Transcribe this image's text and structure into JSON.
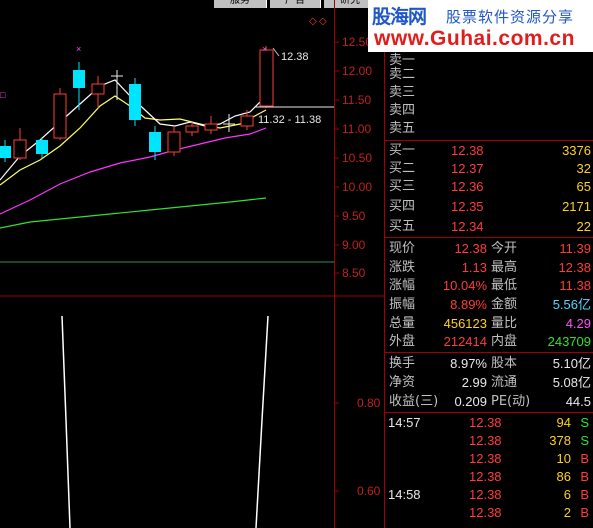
{
  "tabs": [
    "服务",
    "广告",
    "研究"
  ],
  "watermark": {
    "brand": "股海网",
    "slogan": "股票软件资源分享",
    "url": "www.Guhai.com.cn"
  },
  "chart": {
    "price_axis": [
      "12.50",
      "12.00",
      "11.50",
      "11.00",
      "10.50",
      "10.00",
      "9.50",
      "9.00",
      "8.50"
    ],
    "indicator_axis": [
      "0.80",
      "0.60"
    ],
    "high_label": "12.38",
    "range_label": "11.32 - 11.38"
  },
  "colors": {
    "up": "#ff3b3b",
    "down": "#00e5ff",
    "ma5": "#ffffff",
    "ma10": "#ffff66",
    "ma20": "#ff33ff",
    "ma60": "#33e033",
    "grid": "#a00000"
  },
  "sell": [
    {
      "label": "卖五"
    },
    {
      "label": "卖四"
    },
    {
      "label": "卖三"
    },
    {
      "label": "卖二"
    },
    {
      "label": "卖一"
    }
  ],
  "buy": [
    {
      "label": "买一",
      "price": "12.38",
      "vol": "3376"
    },
    {
      "label": "买二",
      "price": "12.37",
      "vol": "32"
    },
    {
      "label": "买三",
      "price": "12.36",
      "vol": "65"
    },
    {
      "label": "买四",
      "price": "12.35",
      "vol": "2171"
    },
    {
      "label": "买五",
      "price": "12.34",
      "vol": "22"
    }
  ],
  "stats": [
    {
      "l1": "现价",
      "v1": "12.38",
      "c1": "red",
      "l2": "今开",
      "v2": "11.39",
      "c2": "red"
    },
    {
      "l1": "涨跌",
      "v1": "1.13",
      "c1": "red",
      "l2": "最高",
      "v2": "12.38",
      "c2": "red"
    },
    {
      "l1": "涨幅",
      "v1": "10.04%",
      "c1": "red",
      "l2": "最低",
      "v2": "11.38",
      "c2": "red"
    },
    {
      "l1": "振幅",
      "v1": "8.89%",
      "c1": "red",
      "l2": "金额",
      "v2": "5.56亿",
      "c2": "cyn"
    },
    {
      "l1": "总量",
      "v1": "456123",
      "c1": "yel",
      "l2": "量比",
      "v2": "4.29",
      "c2": "mag"
    },
    {
      "l1": "外盘",
      "v1": "212414",
      "c1": "red",
      "l2": "内盘",
      "v2": "243709",
      "c2": "grn"
    }
  ],
  "stats2": [
    {
      "l1": "换手",
      "v1": "8.97%",
      "l2": "股本",
      "v2": "5.10亿"
    },
    {
      "l1": "净资",
      "v1": "2.99",
      "l2": "流通",
      "v2": "5.08亿"
    },
    {
      "l1": "收益(三)",
      "v1": "0.209",
      "l2": "PE(动)",
      "v2": "44.5"
    }
  ],
  "ticks": [
    {
      "time": "14:57",
      "price": "12.38",
      "vol": "94",
      "bs": "S"
    },
    {
      "time": "",
      "price": "12.38",
      "vol": "378",
      "bs": "S"
    },
    {
      "time": "",
      "price": "12.38",
      "vol": "10",
      "bs": "B"
    },
    {
      "time": "",
      "price": "12.38",
      "vol": "86",
      "bs": "B"
    },
    {
      "time": "14:58",
      "price": "12.38",
      "vol": "6",
      "bs": "B"
    },
    {
      "time": "",
      "price": "12.38",
      "vol": "2",
      "bs": "B"
    }
  ]
}
